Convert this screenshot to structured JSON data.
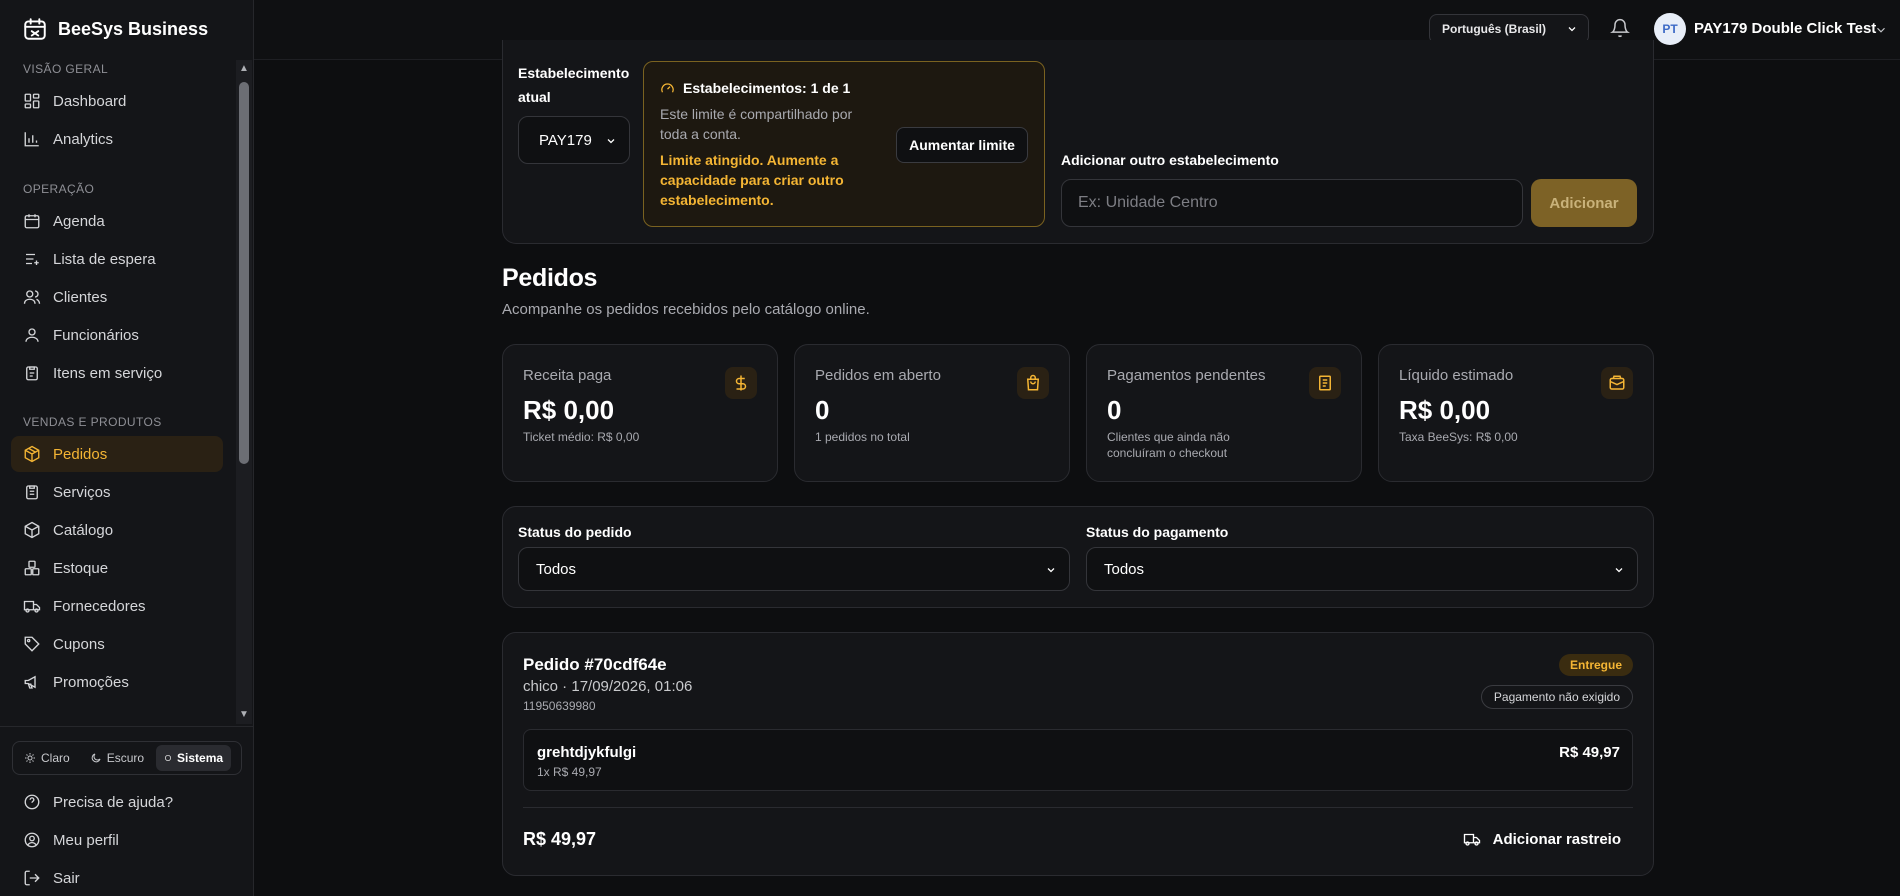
{
  "brand": {
    "title": "BeeSys Business"
  },
  "sidebar": {
    "sections": [
      {
        "title": "VISÃO GERAL",
        "items": [
          {
            "label": "Dashboard"
          },
          {
            "label": "Analytics"
          }
        ]
      },
      {
        "title": "OPERAÇÃO",
        "items": [
          {
            "label": "Agenda"
          },
          {
            "label": "Lista de espera"
          },
          {
            "label": "Clientes"
          },
          {
            "label": "Funcionários"
          },
          {
            "label": "Itens em serviço"
          }
        ]
      },
      {
        "title": "VENDAS E PRODUTOS",
        "items": [
          {
            "label": "Pedidos"
          },
          {
            "label": "Serviços"
          },
          {
            "label": "Catálogo"
          },
          {
            "label": "Estoque"
          },
          {
            "label": "Fornecedores"
          },
          {
            "label": "Cupons"
          },
          {
            "label": "Promoções"
          }
        ]
      }
    ],
    "active_item": "Pedidos",
    "theme": {
      "options": [
        "Claro",
        "Escuro",
        "Sistema"
      ],
      "selected": "Sistema"
    },
    "bottom_links": [
      {
        "label": "Precisa de ajuda?"
      },
      {
        "label": "Meu perfil"
      },
      {
        "label": "Sair"
      }
    ]
  },
  "header": {
    "language": "Português (Brasil)",
    "user": {
      "initials": "PT",
      "name": "PAY179 Double Click Test"
    }
  },
  "establishment": {
    "label": "Estabelecimento atual",
    "selected": "PAY179",
    "limit": {
      "title": "Estabelecimentos: 1 de 1",
      "description": "Este limite é compartilhado por toda a conta.",
      "warning": "Limite atingido. Aumente a capacidade para criar outro estabelecimento.",
      "button": "Aumentar limite"
    },
    "add": {
      "label": "Adicionar outro estabelecimento",
      "placeholder": "Ex: Unidade Centro",
      "button": "Adicionar"
    }
  },
  "page": {
    "title": "Pedidos",
    "subtitle": "Acompanhe os pedidos recebidos pelo catálogo online."
  },
  "stats": [
    {
      "label": "Receita paga",
      "value": "R$ 0,00",
      "sub": "Ticket médio: R$ 0,00",
      "icon": "dollar-icon"
    },
    {
      "label": "Pedidos em aberto",
      "value": "0",
      "sub": "1 pedidos no total",
      "icon": "bag-icon"
    },
    {
      "label": "Pagamentos pendentes",
      "value": "0",
      "sub": "Clientes que ainda não concluíram o checkout",
      "icon": "receipt-icon"
    },
    {
      "label": "Líquido estimado",
      "value": "R$ 0,00",
      "sub": "Taxa BeeSys: R$ 0,00",
      "icon": "wallet-icon"
    }
  ],
  "filters": {
    "order_status": {
      "label": "Status do pedido",
      "value": "Todos"
    },
    "payment_status": {
      "label": "Status do pagamento",
      "value": "Todos"
    }
  },
  "order": {
    "title": "Pedido #70cdf64e",
    "meta": "chico · 17/09/2026, 01:06",
    "phone": "11950639980",
    "status": "Entregue",
    "payment": "Pagamento não exigido",
    "item": {
      "name": "grehtdjykfulgi",
      "qty": "1x R$ 49,97",
      "price": "R$ 49,97"
    },
    "total": "R$ 49,97",
    "track_button": "Adicionar rastreio"
  },
  "colors": {
    "accent": "#f4b534",
    "background": "#0d0e10",
    "card": "#141518"
  }
}
